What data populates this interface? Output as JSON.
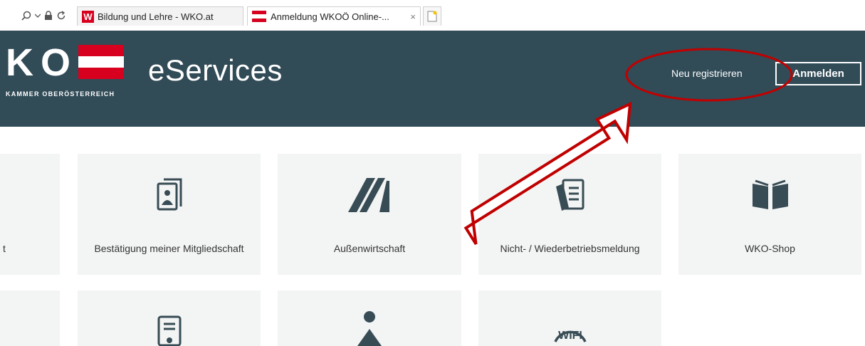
{
  "browser": {
    "tabs": [
      {
        "label": "Bildung und Lehre - WKO.at",
        "favicon_letter": "W"
      },
      {
        "label": "Anmeldung WKOÖ Online-...",
        "close": "×"
      }
    ]
  },
  "header": {
    "logo_letters": [
      "K",
      "O"
    ],
    "logo_subtitle": "KAMMER OBERÖSTERREICH",
    "brand_title": "eServices",
    "register_link": "Neu registrieren",
    "login_button": "Anmelden"
  },
  "tiles_row1": [
    {
      "label": "t",
      "icon": "partial-tile"
    },
    {
      "label": "Bestätigung meiner Mitgliedschaft",
      "icon": "document-person-icon"
    },
    {
      "label": "Außenwirtschaft",
      "icon": "stripes-logo-icon"
    },
    {
      "label": "Nicht- / Wiederbetriebsmeldung",
      "icon": "documents-icon"
    },
    {
      "label": "WKO-Shop",
      "icon": "open-book-icon"
    }
  ],
  "tiles_row2": [
    {
      "icon": "partial-tile"
    },
    {
      "icon": "certificate-icon"
    },
    {
      "icon": "person-reading-icon"
    },
    {
      "icon": "wifi-logo-icon",
      "icon_text": "WIFI"
    }
  ],
  "colors": {
    "header_bg": "#314b57",
    "tile_bg": "#f3f4f4",
    "icon": "#384c55",
    "annotation": "#c00000",
    "flag_red": "#d7001e"
  }
}
